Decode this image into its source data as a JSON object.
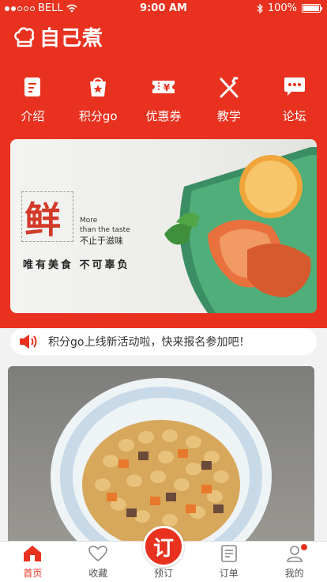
{
  "status_bar": {
    "carrier": "BELL",
    "time": "9:00 AM",
    "battery": "100%"
  },
  "app": {
    "title": "自己煮",
    "logo_icon": "chef-hat-icon"
  },
  "nav": [
    {
      "label": "介绍",
      "icon": "intro-icon"
    },
    {
      "label": "积分go",
      "icon": "points-bag-icon"
    },
    {
      "label": "优惠券",
      "icon": "coupon-icon"
    },
    {
      "label": "教学",
      "icon": "utensils-icon"
    },
    {
      "label": "论坛",
      "icon": "chat-icon"
    }
  ],
  "banner": {
    "big_char": "鲜",
    "more_line1": "More",
    "more_line2": "than the taste",
    "sub": "不止于滋味",
    "slogan": "唯有美食  不可辜负"
  },
  "notice": {
    "text": "积分go上线新活动啦，快来报名参加吧！",
    "icon": "speaker-icon"
  },
  "tabbar": [
    {
      "label": "首页",
      "icon": "home-icon",
      "active": true
    },
    {
      "label": "收藏",
      "icon": "heart-icon",
      "active": false
    },
    {
      "label": "预订",
      "icon": "order-icon",
      "badge_char": "订",
      "active": false
    },
    {
      "label": "订单",
      "icon": "list-icon",
      "active": false
    },
    {
      "label": "我的",
      "icon": "user-icon",
      "active": false
    }
  ],
  "colors": {
    "brand": "#e8321f"
  }
}
